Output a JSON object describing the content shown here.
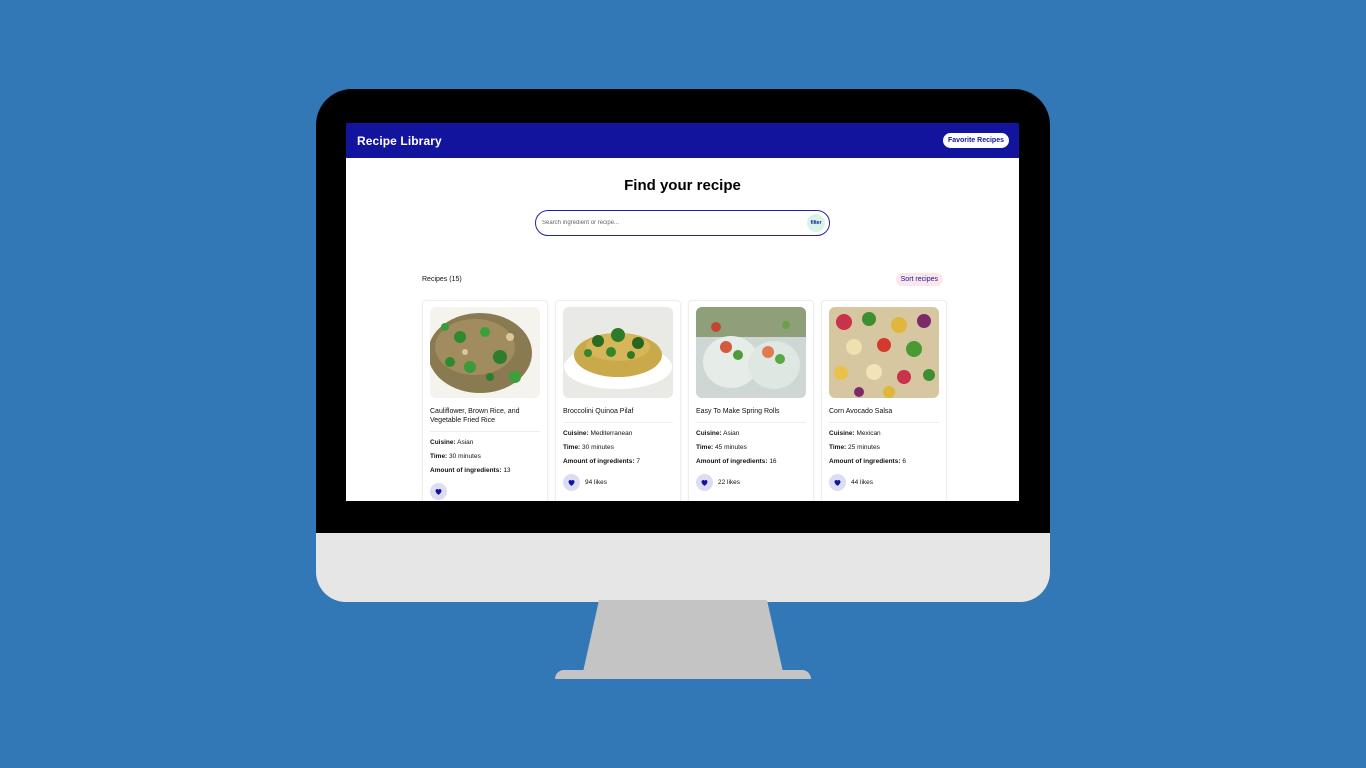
{
  "app": {
    "title": "Recipe Library",
    "favorites_label": "Favorite Recipes"
  },
  "hero": {
    "title": "Find your recipe"
  },
  "search": {
    "placeholder": "Search ingredient or recipe...",
    "filter_label": "filter"
  },
  "list": {
    "count_label": "Recipes (15)",
    "sort_label": "Sort recipes"
  },
  "labels": {
    "cuisine": "Cuisine:",
    "time": "Time:",
    "ingredients": "Amount of ingredients:"
  },
  "recipes": [
    {
      "name": "Cauliflower, Brown Rice, and Vegetable Fried Rice",
      "cuisine": "Asian",
      "time": "30 minutes",
      "ingredients": "13",
      "likes": "",
      "image": "fried-rice-photo"
    },
    {
      "name": "Broccolini Quinoa Pilaf",
      "cuisine": "Mediterranean",
      "time": "30 minutes",
      "ingredients": "7",
      "likes": "94 likes",
      "image": "quinoa-pilaf-photo"
    },
    {
      "name": "Easy To Make Spring Rolls",
      "cuisine": "Asian",
      "time": "45 minutes",
      "ingredients": "16",
      "likes": "22 likes",
      "image": "spring-rolls-photo"
    },
    {
      "name": "Corn Avocado Salsa",
      "cuisine": "Mexican",
      "time": "25 minutes",
      "ingredients": "6",
      "likes": "44 likes",
      "image": "corn-salsa-photo"
    }
  ],
  "colors": {
    "background": "#3277b6",
    "navbar": "#13149e",
    "accent": "#2323b6",
    "sort_bg": "#fde6ea",
    "filter_bg": "#d6f4e8"
  }
}
